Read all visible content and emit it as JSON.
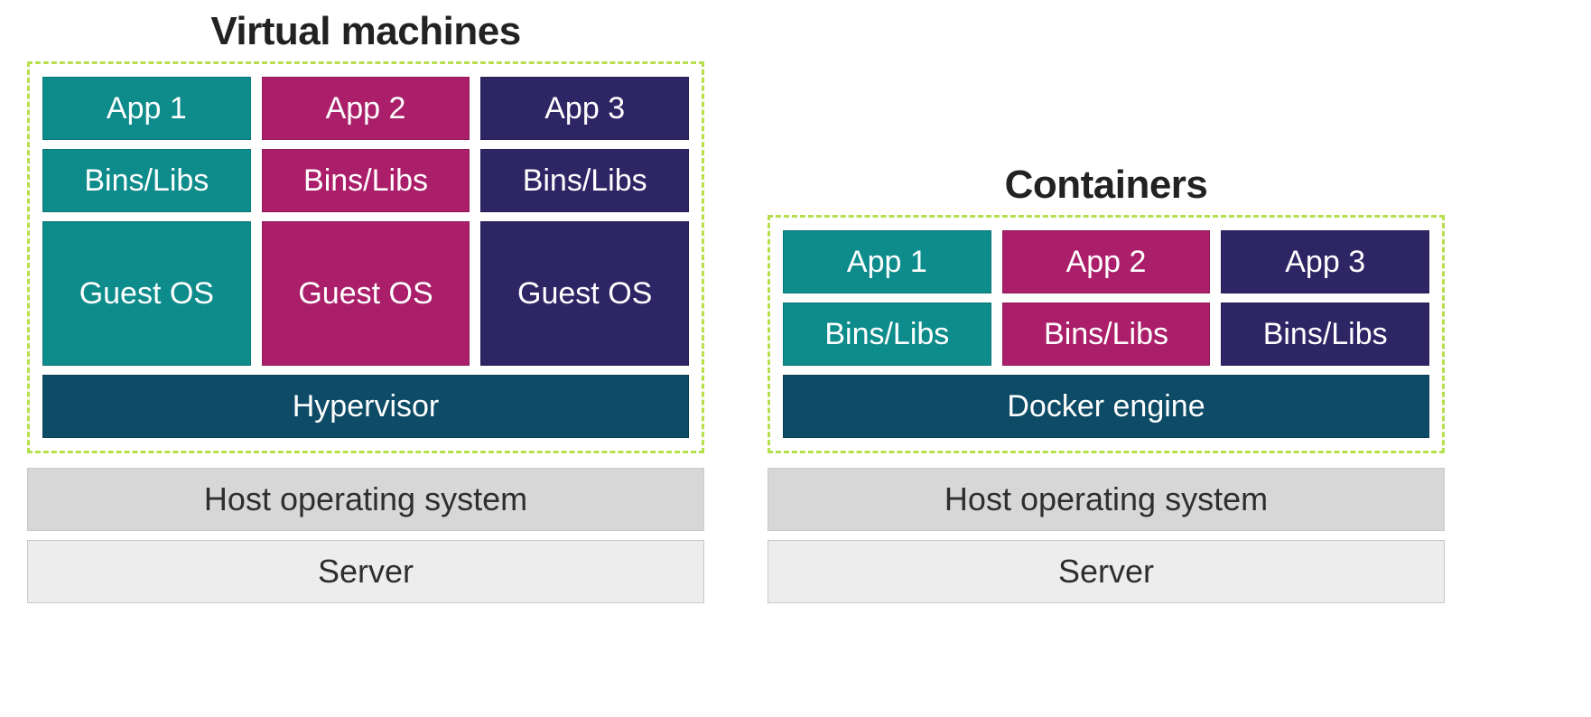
{
  "vm": {
    "title": "Virtual machines",
    "columns": [
      {
        "app": "App 1",
        "bins": "Bins/Libs",
        "guest": "Guest OS",
        "colorApp": "teal",
        "colorBins": "teal",
        "colorGuest": "teal"
      },
      {
        "app": "App 2",
        "bins": "Bins/Libs",
        "guest": "Guest OS",
        "colorApp": "magenta",
        "colorBins": "magenta",
        "colorGuest": "magenta"
      },
      {
        "app": "App 3",
        "bins": "Bins/Libs",
        "guest": "Guest OS",
        "colorApp": "indigo",
        "colorBins": "indigo",
        "colorGuest": "indigo"
      }
    ],
    "hypervisor": "Hypervisor",
    "hostOS": "Host operating system",
    "server": "Server"
  },
  "ct": {
    "title": "Containers",
    "columns": [
      {
        "app": "App 1",
        "bins": "Bins/Libs",
        "colorApp": "teal",
        "colorBins": "teal"
      },
      {
        "app": "App 2",
        "bins": "Bins/Libs",
        "colorApp": "magenta",
        "colorBins": "magenta"
      },
      {
        "app": "App 3",
        "bins": "Bins/Libs",
        "colorApp": "indigo",
        "colorBins": "indigo"
      }
    ],
    "engine": "Docker engine",
    "hostOS": "Host operating system",
    "server": "Server"
  }
}
